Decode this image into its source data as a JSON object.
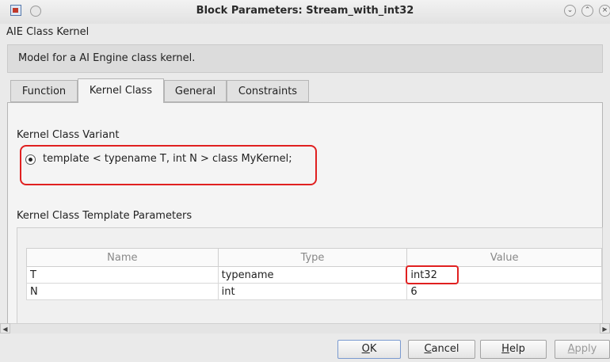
{
  "window": {
    "title": "Block Parameters: Stream_with_int32",
    "block_type": "AIE Class Kernel",
    "description": "Model for a AI Engine class kernel."
  },
  "tabs": [
    {
      "label": "Function",
      "active": false
    },
    {
      "label": "Kernel Class",
      "active": true
    },
    {
      "label": "General",
      "active": false
    },
    {
      "label": "Constraints",
      "active": false
    }
  ],
  "variant": {
    "section_label": "Kernel Class Variant",
    "option_label": "template < typename T, int N > class MyKernel;"
  },
  "params": {
    "section_label": "Kernel Class Template Parameters",
    "columns": [
      "Name",
      "Type",
      "Value"
    ],
    "rows": [
      {
        "name": "T",
        "type": "typename",
        "value": "int32"
      },
      {
        "name": "N",
        "type": "int",
        "value": "6"
      }
    ]
  },
  "buttons": {
    "ok": {
      "prefix": "",
      "key": "O",
      "rest": "K"
    },
    "cancel": {
      "prefix": "",
      "key": "C",
      "rest": "ancel"
    },
    "help": {
      "prefix": "",
      "key": "H",
      "rest": "elp"
    },
    "apply": {
      "prefix": "",
      "key": "A",
      "rest": "pply"
    }
  },
  "colors": {
    "highlight": "#e02020",
    "selected_tab": "#f4f4f4"
  }
}
